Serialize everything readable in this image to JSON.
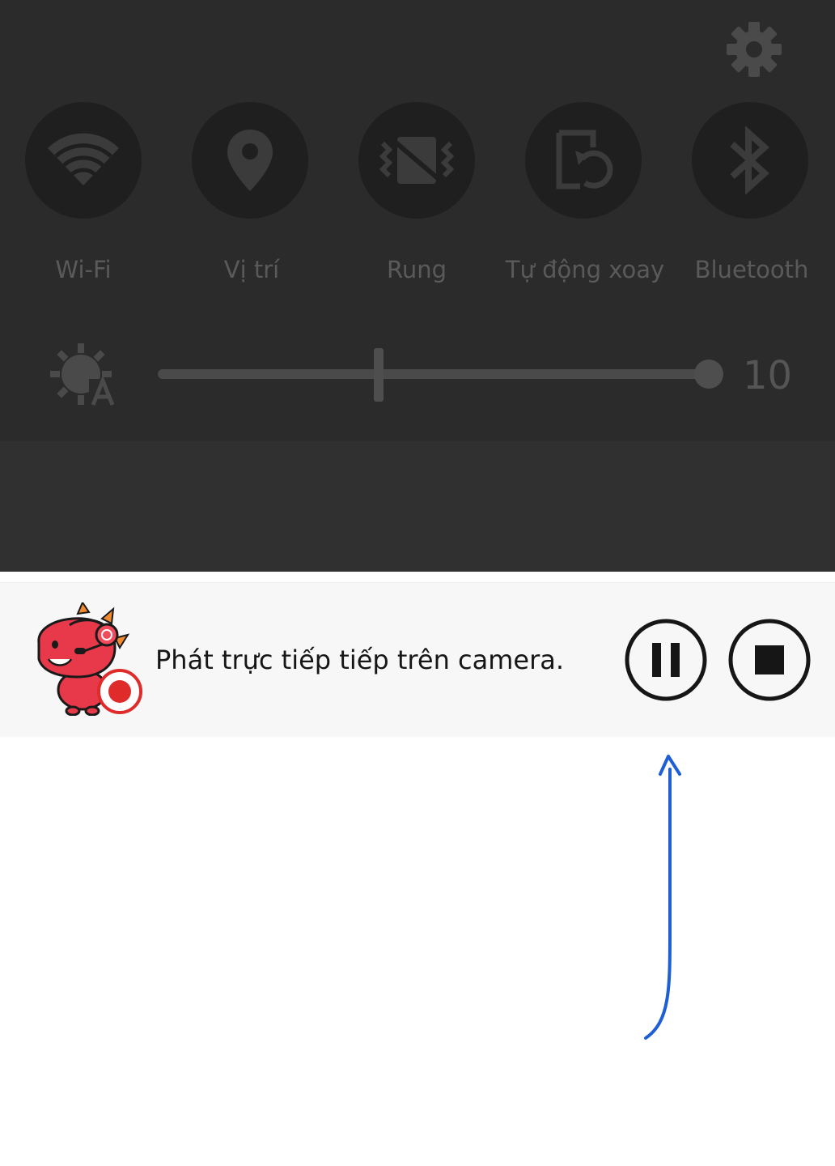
{
  "quick_settings": {
    "tiles": [
      {
        "id": "wifi",
        "label": "Wi-Fi",
        "icon": "wifi-icon"
      },
      {
        "id": "location",
        "label": "Vị trí",
        "icon": "location-pin-icon"
      },
      {
        "id": "vibrate",
        "label": "Rung",
        "icon": "vibrate-icon"
      },
      {
        "id": "autorotate",
        "label": "Tự động xoay",
        "icon": "auto-rotate-icon"
      },
      {
        "id": "bluetooth",
        "label": "Bluetooth",
        "icon": "bluetooth-icon"
      }
    ],
    "brightness": {
      "icon": "auto-brightness-icon",
      "value": "10",
      "level": 1.0
    },
    "settings_icon": "gear-icon"
  },
  "notification": {
    "icon": "dinosaur-mascot-recording-icon",
    "text": "Phát trực tiếp tiếp trên camera.",
    "buttons": [
      {
        "id": "pause",
        "icon": "pause-icon"
      },
      {
        "id": "stop",
        "icon": "stop-icon"
      }
    ]
  },
  "colors": {
    "panel": "#2b2b2b",
    "tile": "#1f1f1f",
    "tile_label": "#5a5a5a",
    "notification_bg": "#f7f7f7",
    "record_red": "#e02b2b",
    "annotation_arrow": "#1f5fd6"
  }
}
